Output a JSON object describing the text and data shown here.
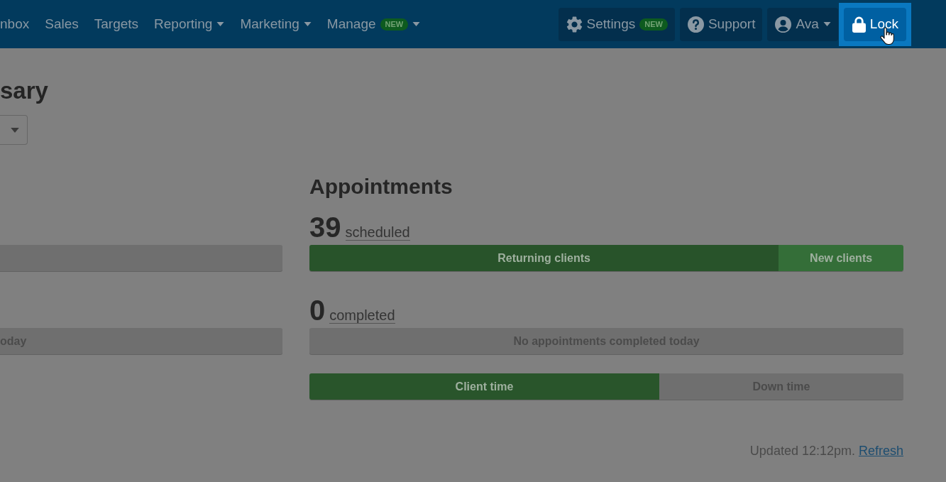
{
  "nav": {
    "items": [
      {
        "label": "nbox",
        "dropdown": false
      },
      {
        "label": "Sales",
        "dropdown": false
      },
      {
        "label": "Targets",
        "dropdown": false
      },
      {
        "label": "Reporting",
        "dropdown": true
      },
      {
        "label": "Marketing",
        "dropdown": true
      },
      {
        "label": "Manage",
        "badge": "NEW",
        "dropdown": true
      }
    ]
  },
  "toolbar": {
    "buttons": [
      {
        "kind": "settings",
        "label": "Settings",
        "badge": "NEW",
        "dropdown": false,
        "highlighted": false
      },
      {
        "kind": "support",
        "label": "Support",
        "dropdown": false,
        "highlighted": false
      },
      {
        "kind": "user",
        "label": "Ava",
        "dropdown": true,
        "highlighted": false
      },
      {
        "kind": "lock",
        "label": "Lock",
        "dropdown": false,
        "highlighted": true
      }
    ]
  },
  "page": {
    "title": "sary"
  },
  "left_column": {
    "bars": [
      {
        "kind": "empty"
      },
      {
        "kind": "message",
        "label": "oday"
      }
    ]
  },
  "appointments": {
    "title": "Appointments",
    "scheduled": {
      "count": "39",
      "label": "scheduled",
      "segments": [
        {
          "label": "Returning clients",
          "level": 0.79,
          "color": "#28532a"
        },
        {
          "label": "New clients",
          "level": 0.21,
          "color": "#346e38"
        }
      ]
    },
    "completed": {
      "count": "0",
      "label": "completed",
      "message": "No appointments completed today"
    },
    "time_bar": {
      "segments": [
        {
          "label": "Client time",
          "level": 0.589,
          "color": "#29552b"
        },
        {
          "label": "Down time",
          "level": 0.411,
          "color": "#6f6f6f"
        }
      ]
    }
  },
  "footer": {
    "updated": "Updated 12:12pm.",
    "link": "Refresh"
  }
}
